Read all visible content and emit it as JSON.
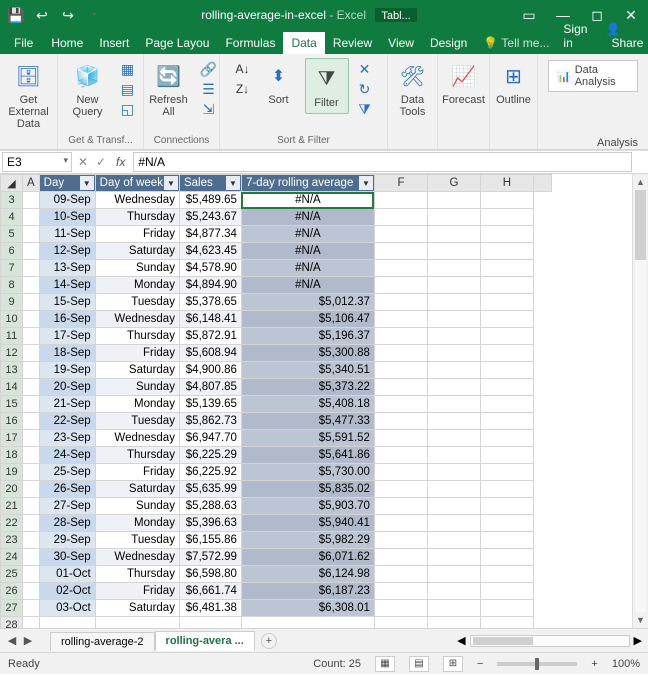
{
  "title": {
    "filename": "rolling-average-in-excel",
    "app": "Excel",
    "context": "Tabl..."
  },
  "menu": {
    "file": "File",
    "home": "Home",
    "insert": "Insert",
    "page": "Page Layou",
    "formulas": "Formulas",
    "data": "Data",
    "review": "Review",
    "view": "View",
    "design": "Design",
    "tell": "Tell me...",
    "signin": "Sign in",
    "share": "Share"
  },
  "ribbon": {
    "get_external": "Get External\nData",
    "new_query": "New\nQuery",
    "refresh": "Refresh\nAll",
    "sort": "Sort",
    "filter": "Filter",
    "data_tools": "Data\nTools",
    "forecast": "Forecast",
    "outline": "Outline",
    "data_analysis": "Data Analysis",
    "g1": "Get & Transf...",
    "g2": "Connections",
    "g3": "Sort & Filter",
    "g4": "Analysis"
  },
  "fx": {
    "cell": "E3",
    "formula": "#N/A"
  },
  "headers": {
    "day": "Day",
    "dow": "Day of week",
    "sales": "Sales",
    "avg": "7-day rolling average",
    "cF": "F",
    "cG": "G",
    "cH": "H",
    "cA": "A"
  },
  "rows": [
    {
      "n": "3",
      "day": "09-Sep",
      "dow": "Wednesday",
      "sales": "$5,489.65",
      "avg": "#N/A"
    },
    {
      "n": "4",
      "day": "10-Sep",
      "dow": "Thursday",
      "sales": "$5,243.67",
      "avg": "#N/A"
    },
    {
      "n": "5",
      "day": "11-Sep",
      "dow": "Friday",
      "sales": "$4,877.34",
      "avg": "#N/A"
    },
    {
      "n": "6",
      "day": "12-Sep",
      "dow": "Saturday",
      "sales": "$4,623.45",
      "avg": "#N/A"
    },
    {
      "n": "7",
      "day": "13-Sep",
      "dow": "Sunday",
      "sales": "$4,578.90",
      "avg": "#N/A"
    },
    {
      "n": "8",
      "day": "14-Sep",
      "dow": "Monday",
      "sales": "$4,894.90",
      "avg": "#N/A"
    },
    {
      "n": "9",
      "day": "15-Sep",
      "dow": "Tuesday",
      "sales": "$5,378.65",
      "avg": "$5,012.37"
    },
    {
      "n": "10",
      "day": "16-Sep",
      "dow": "Wednesday",
      "sales": "$6,148.41",
      "avg": "$5,106.47"
    },
    {
      "n": "11",
      "day": "17-Sep",
      "dow": "Thursday",
      "sales": "$5,872.91",
      "avg": "$5,196.37"
    },
    {
      "n": "12",
      "day": "18-Sep",
      "dow": "Friday",
      "sales": "$5,608.94",
      "avg": "$5,300.88"
    },
    {
      "n": "13",
      "day": "19-Sep",
      "dow": "Saturday",
      "sales": "$4,900.86",
      "avg": "$5,340.51"
    },
    {
      "n": "14",
      "day": "20-Sep",
      "dow": "Sunday",
      "sales": "$4,807.85",
      "avg": "$5,373.22"
    },
    {
      "n": "15",
      "day": "21-Sep",
      "dow": "Monday",
      "sales": "$5,139.65",
      "avg": "$5,408.18"
    },
    {
      "n": "16",
      "day": "22-Sep",
      "dow": "Tuesday",
      "sales": "$5,862.73",
      "avg": "$5,477.33"
    },
    {
      "n": "17",
      "day": "23-Sep",
      "dow": "Wednesday",
      "sales": "$6,947.70",
      "avg": "$5,591.52"
    },
    {
      "n": "18",
      "day": "24-Sep",
      "dow": "Thursday",
      "sales": "$6,225.29",
      "avg": "$5,641.86"
    },
    {
      "n": "19",
      "day": "25-Sep",
      "dow": "Friday",
      "sales": "$6,225.92",
      "avg": "$5,730.00"
    },
    {
      "n": "20",
      "day": "26-Sep",
      "dow": "Saturday",
      "sales": "$5,635.99",
      "avg": "$5,835.02"
    },
    {
      "n": "21",
      "day": "27-Sep",
      "dow": "Sunday",
      "sales": "$5,288.63",
      "avg": "$5,903.70"
    },
    {
      "n": "22",
      "day": "28-Sep",
      "dow": "Monday",
      "sales": "$5,396.63",
      "avg": "$5,940.41"
    },
    {
      "n": "23",
      "day": "29-Sep",
      "dow": "Tuesday",
      "sales": "$6,155.86",
      "avg": "$5,982.29"
    },
    {
      "n": "24",
      "day": "30-Sep",
      "dow": "Wednesday",
      "sales": "$7,572.99",
      "avg": "$6,071.62"
    },
    {
      "n": "25",
      "day": "01-Oct",
      "dow": "Thursday",
      "sales": "$6,598.80",
      "avg": "$6,124.98"
    },
    {
      "n": "26",
      "day": "02-Oct",
      "dow": "Friday",
      "sales": "$6,661.74",
      "avg": "$6,187.23"
    },
    {
      "n": "27",
      "day": "03-Oct",
      "dow": "Saturday",
      "sales": "$6,481.38",
      "avg": "$6,308.01"
    },
    {
      "n": "28",
      "day": "",
      "dow": "",
      "sales": "",
      "avg": ""
    }
  ],
  "sheets": {
    "s1": "rolling-average-2",
    "s2": "rolling-avera ..."
  },
  "status": {
    "ready": "Ready",
    "count": "Count: 25",
    "zoom": "100%"
  }
}
